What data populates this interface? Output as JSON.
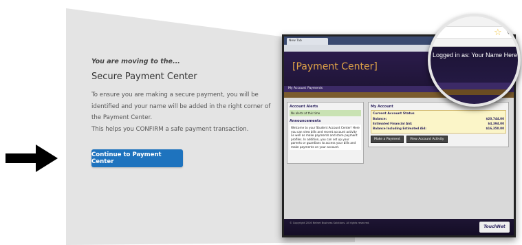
{
  "intro": "You are moving to the...",
  "heading": "Secure Payment Center",
  "paragraph1": "To ensure you are making a secure payment, you will be identified and your name will be added in the right corner of the Payment Center.",
  "paragraph2": "This helps you CONFIRM a safe payment transaction.",
  "cta_label": "Continue to Payment Center",
  "accent_color": "#1e73be",
  "arrow_icon": "right-arrow-icon",
  "screenshot": {
    "tab_label": "New Tab",
    "title": "[Payment Center]",
    "nav": [
      "My Account",
      "Payments"
    ],
    "alerts_title": "Account Alerts",
    "alerts_ok": "No alerts at this time",
    "announcements_title": "Announcements",
    "announcement_text": "Welcome to your Student Account Center! Here you can view bills and recent account activity as well as make payments and store payment profiles. In addition, you can set up your parents or guardians to access your bills and make payments on your account.",
    "my_account_title": "My Account",
    "status_title": "Current Account Status",
    "rows": [
      {
        "label": "Balance:",
        "value": "$20,744.00"
      },
      {
        "label": "Estimated Financial Aid:",
        "value": "$4,394.00"
      },
      {
        "label": "Balance Including Estimated Aid:",
        "value": "$16,350.00"
      }
    ],
    "make_payment": "Make a Payment",
    "view_activity": "View Account Activity",
    "footer_text": "© Copyright 2016 Nelnet Business Solutions. All rights reserved.",
    "footer_logo": "TouchNet"
  },
  "zoom": {
    "logged_in": "Logged in as: Your Name Here",
    "star_icon": "star-icon",
    "gear_icon": "gear-icon"
  }
}
